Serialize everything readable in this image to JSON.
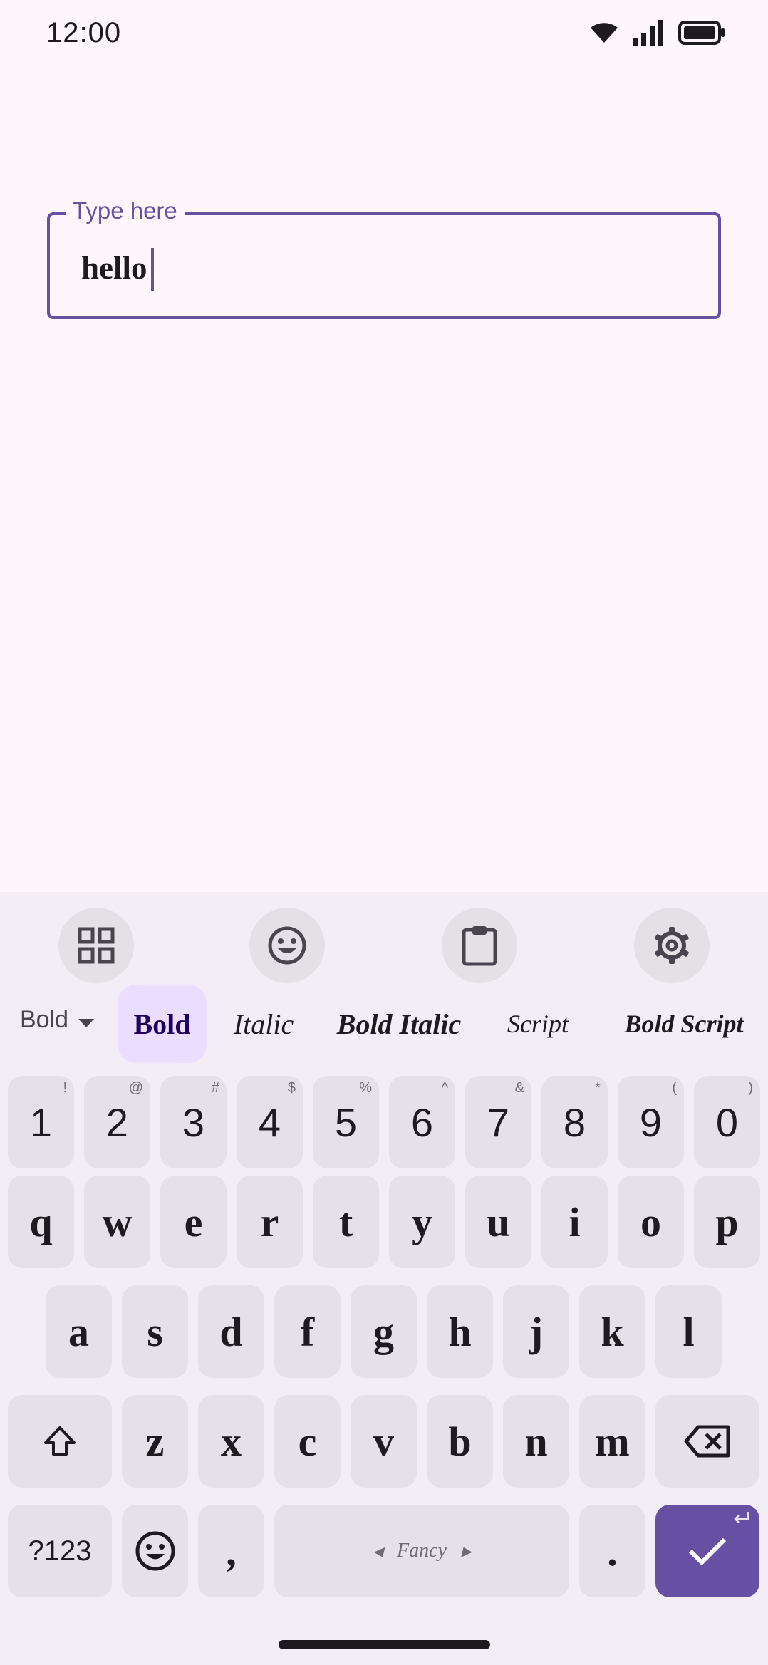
{
  "status_bar": {
    "time": "12:00"
  },
  "text_field": {
    "label": "Type here",
    "value": "hello"
  },
  "keyboard": {
    "toolbar": [
      "grid-icon",
      "emoji-icon",
      "clipboard-icon",
      "settings-icon"
    ],
    "style_selector": {
      "current": "Bold"
    },
    "style_options": [
      "Bold",
      "Italic",
      "Bold Italic",
      "Script",
      "Bold Script"
    ],
    "selected_style": "Bold",
    "number_row": [
      {
        "key": "1",
        "hint": "!"
      },
      {
        "key": "2",
        "hint": "@"
      },
      {
        "key": "3",
        "hint": "#"
      },
      {
        "key": "4",
        "hint": "$"
      },
      {
        "key": "5",
        "hint": "%"
      },
      {
        "key": "6",
        "hint": "^"
      },
      {
        "key": "7",
        "hint": "&"
      },
      {
        "key": "8",
        "hint": "*"
      },
      {
        "key": "9",
        "hint": "("
      },
      {
        "key": "0",
        "hint": ")"
      }
    ],
    "row1": [
      "q",
      "w",
      "e",
      "r",
      "t",
      "y",
      "u",
      "i",
      "o",
      "p"
    ],
    "row2": [
      "a",
      "s",
      "d",
      "f",
      "g",
      "h",
      "j",
      "k",
      "l"
    ],
    "row3": [
      "z",
      "x",
      "c",
      "v",
      "b",
      "n",
      "m"
    ],
    "bottom": {
      "symbols": "?123",
      "comma": ",",
      "space": "Fancy",
      "period": "."
    },
    "accent_color": "#6750a4"
  }
}
